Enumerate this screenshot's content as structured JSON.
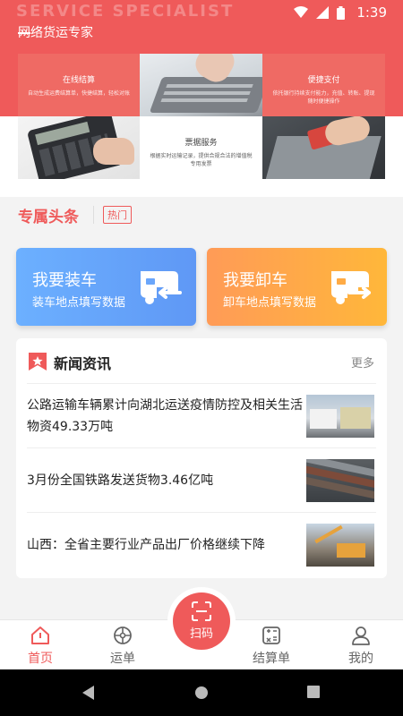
{
  "status_bar": {
    "ghost_text": "SERVICE SPECIALIST",
    "time": "1:39"
  },
  "header": {
    "app_title": "网络货运专家"
  },
  "banner": {
    "tiles": [
      {
        "title": "在线结算",
        "desc": "自动生成运费结算单，快捷结算，轻松对账"
      },
      {
        "title": "便捷支付",
        "desc": "依托银行持续支付能力，充值、转账、提现随时便捷操作"
      },
      {
        "title": "票据服务",
        "desc": "根据实时运输记录，提供合规合法的增值税专用发票"
      }
    ]
  },
  "headlines": {
    "title": "专属头条",
    "tag": "热门"
  },
  "actions": [
    {
      "title": "我要装车",
      "subtitle": "装车地点填写数据",
      "color": "#6cb0ff"
    },
    {
      "title": "我要卸车",
      "subtitle": "卸车地点填写数据",
      "color": "#ffa24a"
    }
  ],
  "news": {
    "title": "新闻资讯",
    "more": "更多",
    "items": [
      {
        "title": "公路运输车辆累计向湖北运送疫情防控及相关生活物资49.33万吨"
      },
      {
        "title": "3月份全国铁路发送货物3.46亿吨"
      },
      {
        "title": "山西：全省主要行业产品出厂价格继续下降"
      }
    ]
  },
  "tabbar": {
    "home": "首页",
    "waybill": "运单",
    "scan": "扫码",
    "settlement": "结算单",
    "mine": "我的",
    "active_color": "#ef5a5a"
  },
  "colors": {
    "brand": "#ef5a5a"
  }
}
